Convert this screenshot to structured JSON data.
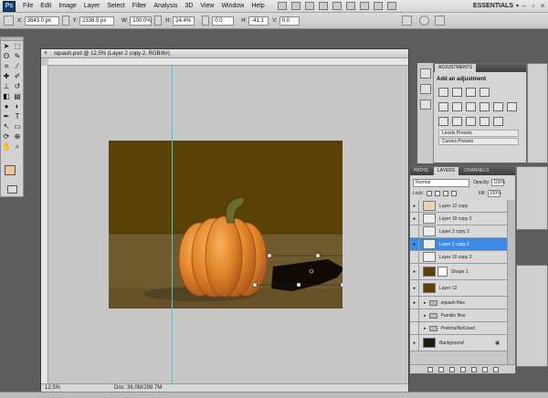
{
  "app": {
    "logo_text": "Ps",
    "menu": [
      "File",
      "Edit",
      "Image",
      "Layer",
      "Select",
      "Filter",
      "Analysis",
      "3D",
      "View",
      "Window",
      "Help"
    ],
    "workspace": "ESSENTIALS",
    "workspace_arrow": "▾"
  },
  "options": {
    "x_label": "X:",
    "x_value": "3843.0 px",
    "y_label": "Y:",
    "y_value": "2338.5 px",
    "w_label": "W:",
    "w_value": "100.0%",
    "h_label": "H:",
    "h_value": "24.4%",
    "angle_value": "0.0",
    "h_skew_label": "H:",
    "h_skew_value": "-41.1",
    "v_skew_label": "V:",
    "v_skew_value": "0.0"
  },
  "document": {
    "close": "×",
    "title": "squash.psd @ 12.5% (Layer 2 copy 2, RGB/8#)",
    "zoom": "12.5%",
    "doc_size": "Doc: 36.0M/299.7M"
  },
  "adjustments": {
    "tab": "ADJUSTMENTS",
    "title": "Add an adjustment",
    "presets": [
      "Levels Presets",
      "Curves Presets"
    ]
  },
  "layers_panel": {
    "tabs": [
      "PATHS",
      "LAYERS",
      "CHANNELS"
    ],
    "blend_mode": "Normal",
    "opacity_label": "Opacity:",
    "opacity_value": "100%",
    "lock_label": "Lock:",
    "fill_label": "Fill:",
    "fill_value": "100%",
    "layers": [
      {
        "name": "Layer 12 copy",
        "visible": true,
        "selected": false,
        "kind": "pixel"
      },
      {
        "name": "Layer 10 copy 2",
        "visible": true,
        "selected": false,
        "kind": "pixel"
      },
      {
        "name": "Layer 2 copy 3",
        "visible": false,
        "selected": false,
        "kind": "pixel"
      },
      {
        "name": "Layer 2 copy 2",
        "visible": true,
        "selected": true,
        "kind": "pixel"
      },
      {
        "name": "Layer 10 copy 2",
        "visible": false,
        "selected": false,
        "kind": "pixel"
      },
      {
        "name": "Shape 1",
        "visible": true,
        "selected": false,
        "kind": "shape"
      },
      {
        "name": "Layer 12",
        "visible": true,
        "selected": false,
        "kind": "pixel"
      },
      {
        "name": "squash files",
        "visible": true,
        "selected": false,
        "kind": "folder"
      },
      {
        "name": "Pumkin files",
        "visible": false,
        "selected": false,
        "kind": "folder"
      },
      {
        "name": "Prelims/NotUsed",
        "visible": false,
        "selected": false,
        "kind": "folder"
      },
      {
        "name": "Background",
        "visible": true,
        "selected": false,
        "kind": "background"
      }
    ]
  },
  "colors": {
    "foreground": "#f0c49a",
    "background": "#ffffff",
    "selection": "#3b8ae6",
    "guide": "#4fc5d8"
  }
}
